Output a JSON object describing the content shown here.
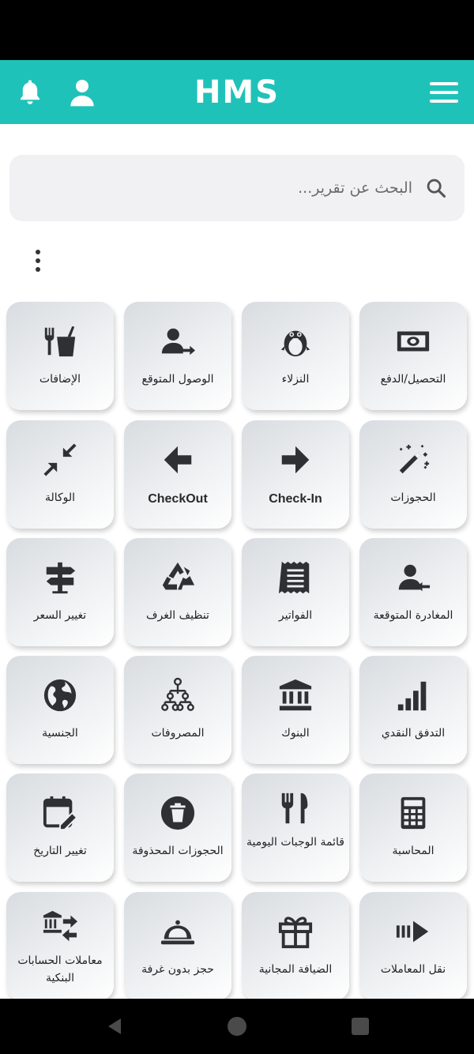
{
  "app": {
    "title": "HMS"
  },
  "search": {
    "placeholder": "البحث عن تقرير..."
  },
  "colors": {
    "primary": "#1fc2b8",
    "icon": "#2f3033"
  },
  "tiles": [
    {
      "label": "التحصيل/الدفع",
      "icon": "money-icon"
    },
    {
      "label": "النزلاء",
      "icon": "penguin-icon"
    },
    {
      "label": "الوصول المتوقع",
      "icon": "person-arrow-right-icon"
    },
    {
      "label": "الإضافات",
      "icon": "restaurant-drink-icon"
    },
    {
      "label": "الحجوزات",
      "icon": "magic-wand-icon"
    },
    {
      "label": "Check-In",
      "icon": "arrow-right-icon"
    },
    {
      "label": "CheckOut",
      "icon": "arrow-left-icon"
    },
    {
      "label": "الوكالة",
      "icon": "collapse-icon"
    },
    {
      "label": "المغادرة المتوقعة",
      "icon": "person-arrow-left-icon"
    },
    {
      "label": "الفواتير",
      "icon": "receipt-icon"
    },
    {
      "label": "تنظيف الغرف",
      "icon": "recycle-icon"
    },
    {
      "label": "تغيير السعر",
      "icon": "signpost-icon"
    },
    {
      "label": "التدفق النقدي",
      "icon": "signal-bars-icon"
    },
    {
      "label": "البنوك",
      "icon": "bank-icon"
    },
    {
      "label": "المصروفات",
      "icon": "hierarchy-icon"
    },
    {
      "label": "الجنسية",
      "icon": "globe-icon"
    },
    {
      "label": "المحاسبة",
      "icon": "calculator-icon"
    },
    {
      "label": "قائمة الوجبات اليومية",
      "icon": "fork-knife-icon"
    },
    {
      "label": "الحجوزات المحذوفة",
      "icon": "trash-circle-icon"
    },
    {
      "label": "تغيير التاريخ",
      "icon": "calendar-edit-icon"
    },
    {
      "label": "نقل المعاملات",
      "icon": "transfer-arrow-icon"
    },
    {
      "label": "الضيافة المجانية",
      "icon": "gift-icon"
    },
    {
      "label": "حجز بدون غرفة",
      "icon": "room-service-icon"
    },
    {
      "label": "معاملات الحسابات البنكية",
      "icon": "bank-transfer-icon"
    }
  ]
}
